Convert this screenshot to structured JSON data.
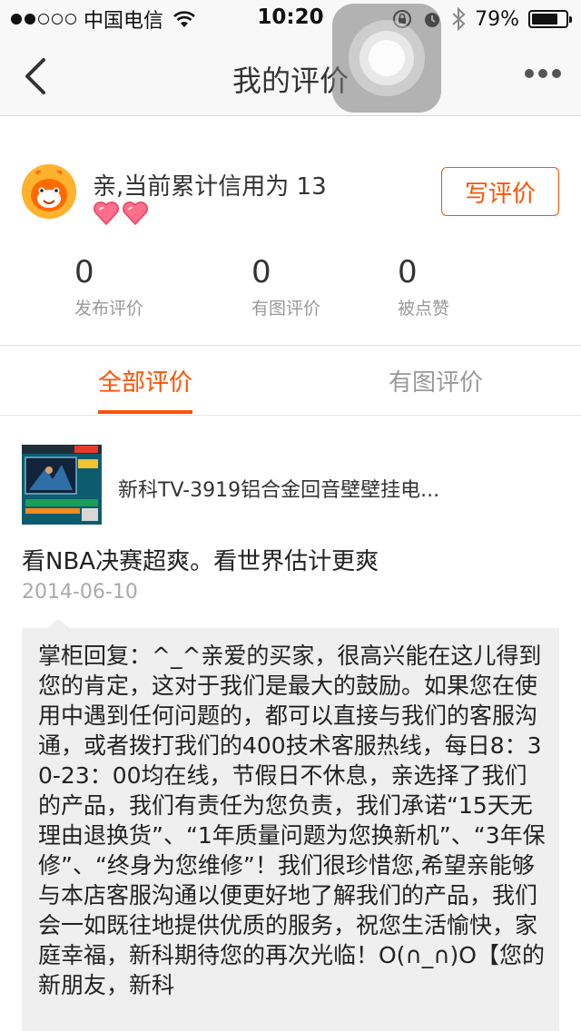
{
  "status_bar": {
    "carrier": "中国电信",
    "time": "10:20",
    "battery": "79%",
    "battery_level": 0.79,
    "signal_bars_filled": 2,
    "signal_bars_total": 5
  },
  "nav": {
    "title": "我的评价",
    "back_icon": "chevron-left-icon",
    "more_icon": "more-dots-icon"
  },
  "profile": {
    "credit_text": "亲,当前累计信用为 13",
    "heart_count": 2,
    "write_review_label": "写评价",
    "stats": [
      {
        "value": "0",
        "label": "发布评价"
      },
      {
        "value": "0",
        "label": "有图评价"
      },
      {
        "value": "0",
        "label": "被点赞"
      }
    ]
  },
  "tabs": [
    {
      "label": "全部评价",
      "active": true
    },
    {
      "label": "有图评价",
      "active": false
    }
  ],
  "review": {
    "product_name": "新科TV-3919铝合金回音壁壁挂电...",
    "content": "看NBA决赛超爽。看世界估计更爽",
    "date": "2014-06-10",
    "reply": "掌柜回复：^_^亲爱的买家，很高兴能在这儿得到您的肯定，这对于我们是最大的鼓励。如果您在使用中遇到任何问题的，都可以直接与我们的客服沟通，或者拨打我们的400技术客服热线，每日8：30-23：00均在线，节假日不休息，亲选择了我们的产品，我们有责任为您负责，我们承诺“15天无理由退换货”、“1年质量问题为您换新机”、“3年保修”、“终身为您维修”！我们很珍惜您,希望亲能够与本店客服沟通以便更好地了解我们的产品，我们会一如既往地提供优质的服务，祝您生活愉快，家庭幸福，新科期待您的再次光临！O(∩_∩)O【您的新朋友，新科"
  },
  "colors": {
    "accent": "#ff5000",
    "muted": "#999999",
    "reply_bg": "#efefef"
  }
}
